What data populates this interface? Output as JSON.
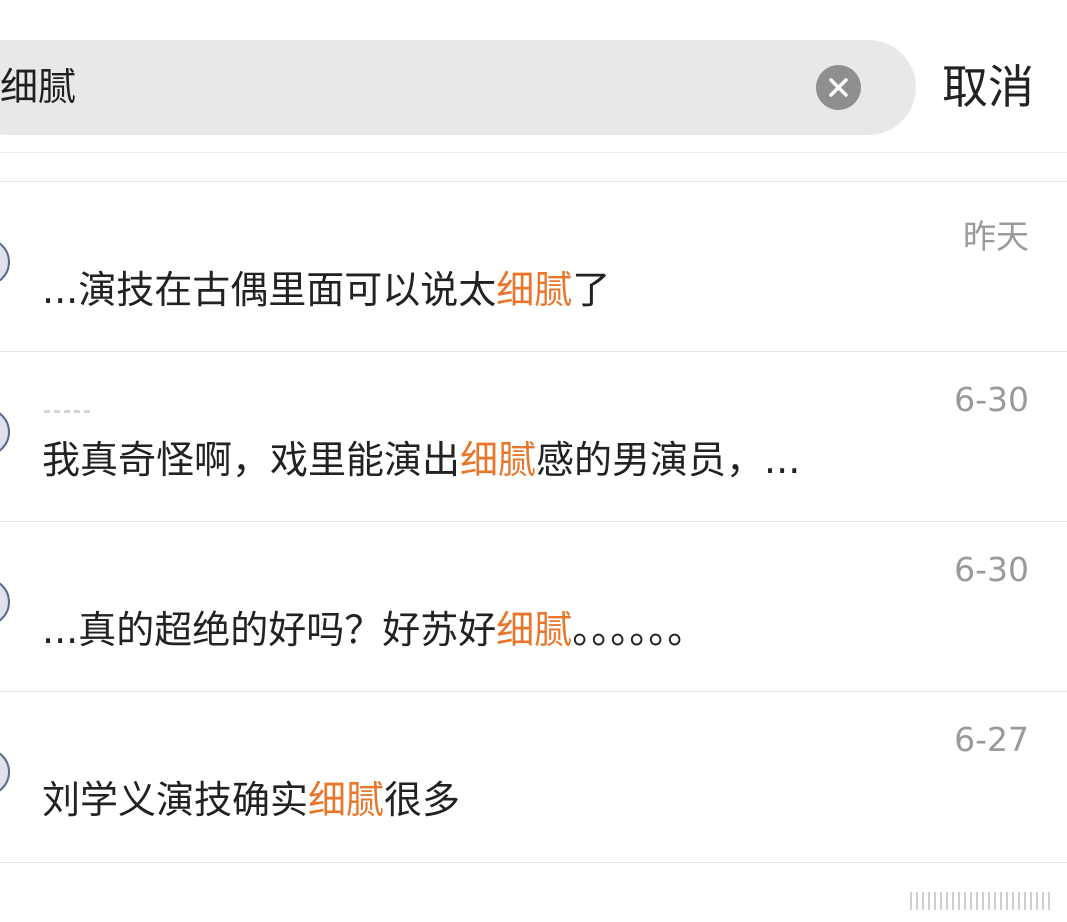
{
  "search": {
    "query": "细腻",
    "cancel_label": "取消",
    "clear_icon": "close-circle-icon"
  },
  "results": [
    {
      "date": "昨天",
      "before": "...演技在古偶里面可以说太",
      "keyword": "细腻",
      "after": "了"
    },
    {
      "date": "6-30",
      "before": "我真奇怪啊，戏里能演出",
      "keyword": "细腻",
      "after": "感的男演员，..."
    },
    {
      "date": "6-30",
      "before": "...真的超绝的好吗？好苏好",
      "keyword": "细腻",
      "after": "。。。。。。"
    },
    {
      "date": "6-27",
      "before": "刘学义演技确实",
      "keyword": "细腻",
      "after": "很多"
    }
  ],
  "colors": {
    "highlight": "#e8762b",
    "search_bg": "#e8e8ea",
    "date": "#9a9a9a"
  }
}
